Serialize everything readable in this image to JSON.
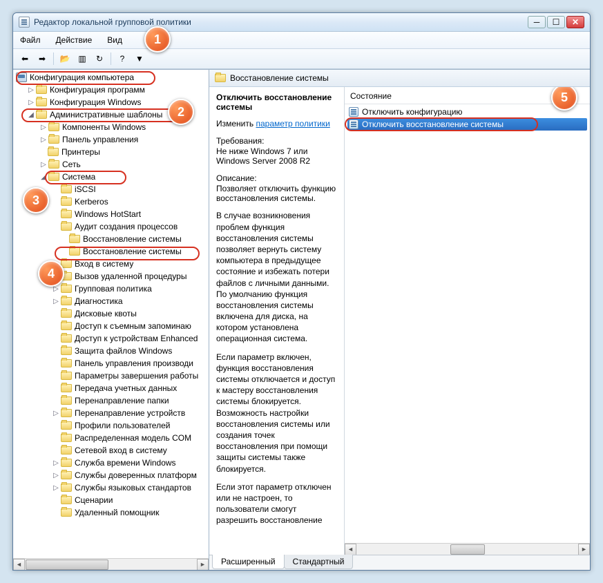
{
  "window": {
    "title": "Редактор локальной групповой политики"
  },
  "menu": {
    "file": "Файл",
    "action": "Действие",
    "view": "Вид"
  },
  "tree": {
    "root": "Конфигурация компьютера",
    "sub1": "Конфигурация программ",
    "sub2": "Конфигурация Windows",
    "admin": "Административные шаблоны",
    "komp": "Компоненты Windows",
    "panel": "Панель управления",
    "printers": "Принтеры",
    "network": "Сеть",
    "system": "Система",
    "items": [
      "iSCSI",
      "Kerberos",
      "Windows HotStart",
      "Аудит создания процессов",
      "Восстановление системы",
      "Восстановление системы",
      "Вход в систему",
      "Вызов удаленной процедуры",
      "Групповая политика",
      "Диагностика",
      "Дисковые квоты",
      "Доступ к съемным запоминаю",
      "Доступ к устройствам Enhanced",
      "Защита файлов Windows",
      "Панель управления производи",
      "Параметры завершения работы",
      "Передача учетных данных",
      "Перенаправление папки",
      "Перенаправление устройств",
      "Профили пользователей",
      "Распределенная модель COM",
      "Сетевой вход в систему",
      "Служба времени Windows",
      "Службы доверенных платформ",
      "Службы языковых стандартов",
      "Сценарии",
      "Удаленный помощник"
    ]
  },
  "right": {
    "header": "Восстановление системы",
    "desc_title": "Отключить восстановление системы",
    "change_label": "Изменить",
    "change_link": "параметр политики",
    "req_label": "Требования:",
    "req_text": "Не ниже Windows 7 или Windows Server 2008 R2",
    "desc_label": "Описание:",
    "desc_p1": "Позволяет отключить функцию восстановления системы.",
    "desc_p2": "В случае возникновения проблем функция восстановления системы позволяет вернуть систему компьютера в предыдущее состояние и избежать потери файлов с личными данными. По умолчанию функция восстановления системы включена для диска, на котором установлена операционная система.",
    "desc_p3": "Если параметр включен, функция восстановления системы отключается и доступ к мастеру восстановления системы блокируется. Возможность настройки восстановления системы или создания точек восстановления при помощи защиты системы также блокируется.",
    "desc_p4": "Если этот параметр отключен или не настроен, то пользователи смогут разрешить восстановление",
    "state_header": "Состояние",
    "setting1": "Отключить конфигурацию",
    "setting2": "Отключить восстановление системы"
  },
  "tabs": {
    "ext": "Расширенный",
    "std": "Стандартный"
  },
  "callouts": [
    "1",
    "2",
    "3",
    "4",
    "5"
  ]
}
